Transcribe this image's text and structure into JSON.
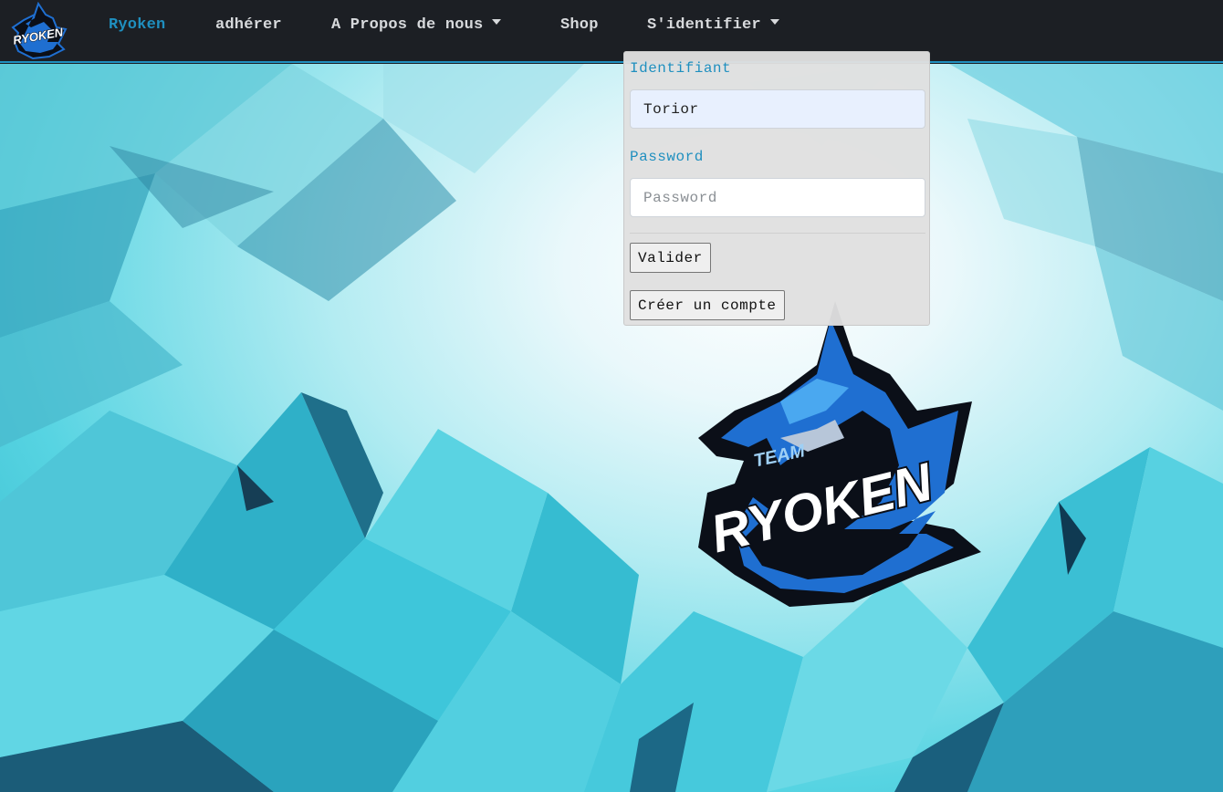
{
  "navbar": {
    "brand_logo_text": "RYOKEN",
    "items": [
      {
        "label": "Ryoken",
        "active": true
      },
      {
        "label": "adhérer"
      },
      {
        "label": "A Propos de nous",
        "dropdown": true
      },
      {
        "label": "Shop"
      },
      {
        "label": "S'identifier",
        "dropdown": true
      }
    ]
  },
  "login": {
    "username_label": "Identifiant",
    "username_value": "Torior",
    "password_label": "Password",
    "password_placeholder": "Password",
    "submit_label": "Valider",
    "create_account_label": "Créer un compte"
  },
  "hero_logo": {
    "text_small": "TEAM",
    "text_large": "RYOKEN"
  },
  "colors": {
    "navbar_bg": "#1c1f24",
    "accent": "#1f8fbf",
    "nav_text": "#d7d9dc",
    "dropdown_bg": "#e0e0e0"
  }
}
